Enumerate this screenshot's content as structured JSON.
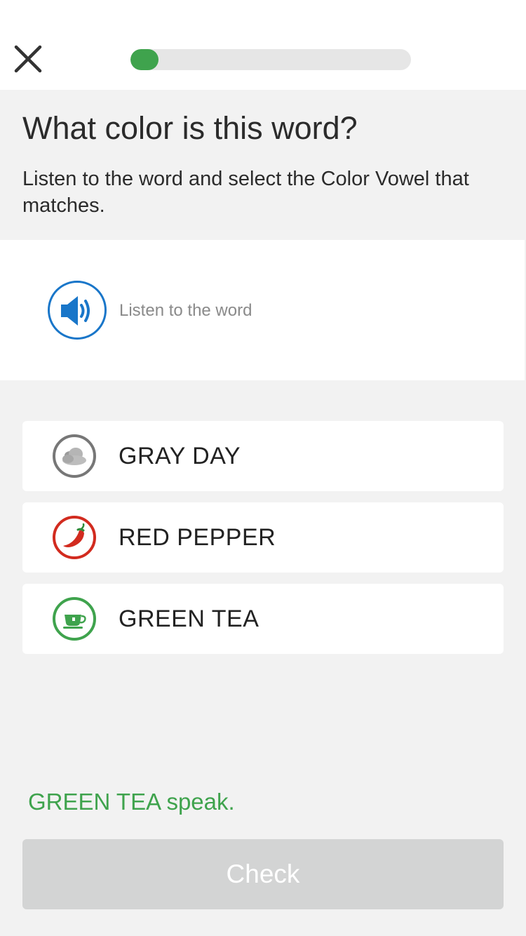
{
  "header": {
    "close_icon": "close-icon",
    "progress_fraction": 0.1,
    "progress_color": "#3fa34d"
  },
  "question": {
    "title": "What color is this word?",
    "instructions": "Listen to the word and select the Color Vowel that matches."
  },
  "listen": {
    "icon": "speaker-icon",
    "label": "Listen to the word",
    "accent": "#1976c9"
  },
  "options": [
    {
      "label": "GRAY DAY",
      "icon": "cloud-icon",
      "color": "#777777"
    },
    {
      "label": "RED PEPPER",
      "icon": "chili-pepper-icon",
      "color": "#d22b1f"
    },
    {
      "label": "GREEN TEA",
      "icon": "tea-cup-icon",
      "color": "#3fa34d"
    }
  ],
  "feedback": {
    "text": "GREEN TEA speak.",
    "color": "#3fa34d"
  },
  "footer": {
    "check_label": "Check"
  }
}
